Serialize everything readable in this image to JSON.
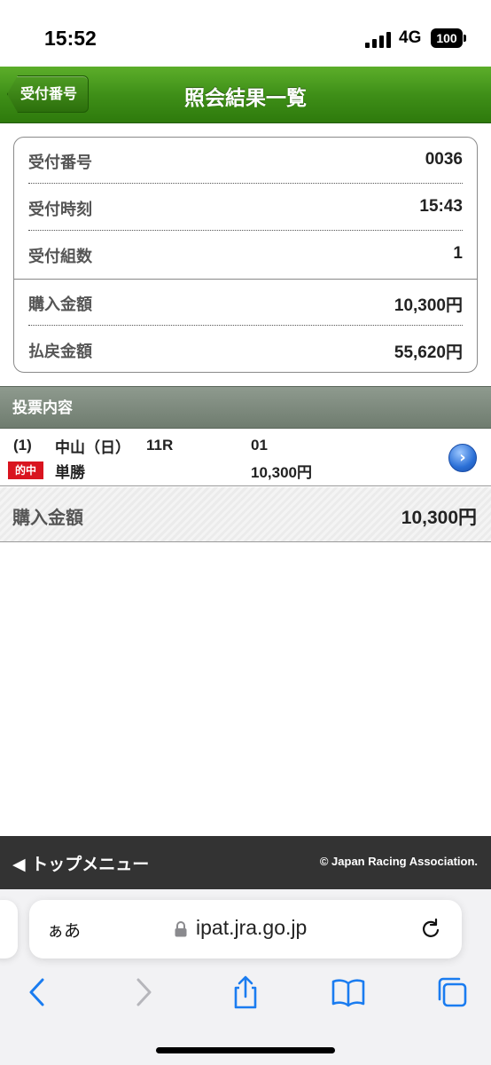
{
  "status_bar": {
    "time": "15:52",
    "network": "4G",
    "battery": "100"
  },
  "header": {
    "back_label": "受付番号",
    "title": "照会結果一覧",
    "color": "#3f8f18"
  },
  "summary": {
    "rows": [
      {
        "label": "受付番号",
        "value": "0036"
      },
      {
        "label": "受付時刻",
        "value": "15:43"
      },
      {
        "label": "受付組数",
        "value": "1"
      },
      {
        "label": "購入金額",
        "value": "10,300円"
      },
      {
        "label": "払戻金額",
        "value": "55,620円"
      }
    ]
  },
  "bets": {
    "section_title": "投票内容",
    "items": [
      {
        "number": "(1)",
        "venue": "中山（日）",
        "race": "11R",
        "horse": "01",
        "hit_badge": "的中",
        "bet_type": "単勝",
        "amount": "10,300円"
      }
    ],
    "total_label": "購入金額",
    "total_value": "10,300円"
  },
  "footer": {
    "top_menu": "トップメニュー",
    "copyright": "© Japan Racing Association."
  },
  "browser": {
    "aa_label": "ぁあ",
    "url": "ipat.jra.go.jp",
    "accent_color": "#1a7cf0"
  }
}
